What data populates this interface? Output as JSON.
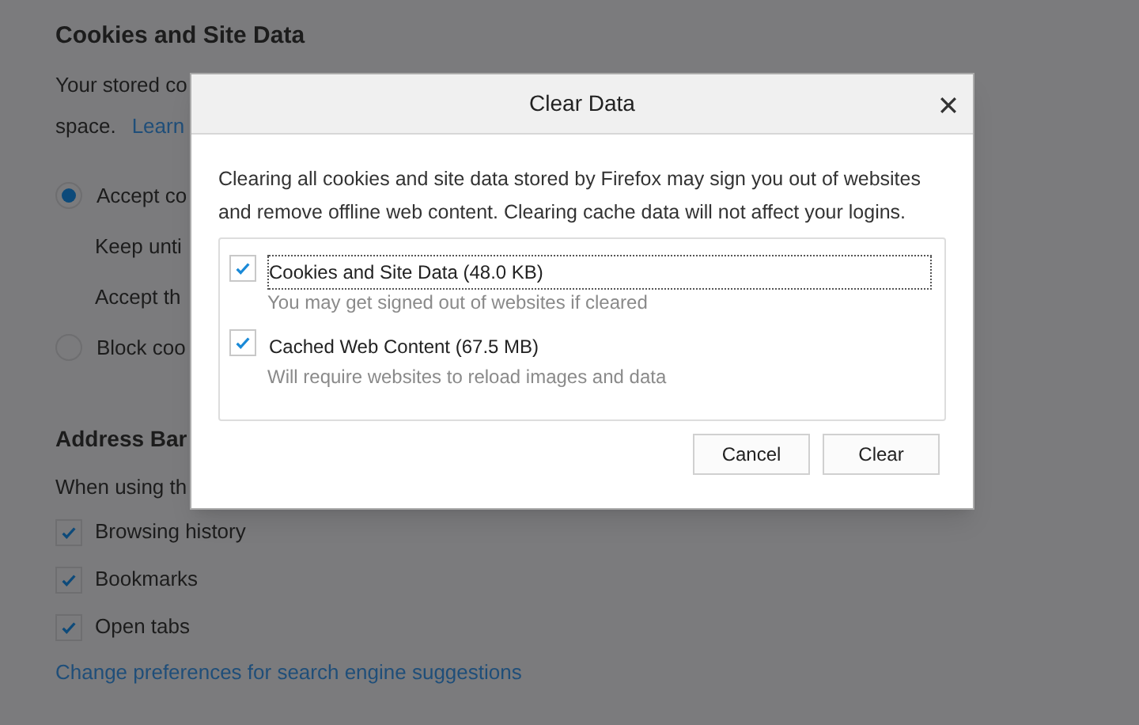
{
  "page": {
    "cookies_section": {
      "heading": "Cookies and Site Data",
      "description": "Your stored co",
      "description_line_2": "space.",
      "learn_link": "Learn",
      "options": [
        {
          "kind": "radio",
          "label": "Accept co",
          "selected": true
        },
        {
          "kind": "sub",
          "label": "Keep unti"
        },
        {
          "kind": "sub",
          "label": "Accept th"
        },
        {
          "kind": "radio",
          "label": "Block coo",
          "selected": false
        }
      ]
    },
    "address_bar_section": {
      "heading": "Address Bar",
      "description": "When using th",
      "options": [
        {
          "label": "Browsing history",
          "checked": true
        },
        {
          "label": "Bookmarks",
          "checked": true
        },
        {
          "label": "Open tabs",
          "checked": true
        }
      ],
      "link": "Change preferences for search engine suggestions"
    }
  },
  "dialog": {
    "heading": "Clear Data",
    "message": "Clearing all cookies and site data stored by Firefox may sign you out of websites and remove offline web content. Clearing cache data will not affect your logins.",
    "items": [
      {
        "label": "Cookies and Site Data (48.0 KB)",
        "note": "You may get signed out of websites if cleared",
        "checked": true,
        "focused": true
      },
      {
        "label": "Cached Web Content (67.5 MB)",
        "note": "Will require websites to reload images and data",
        "checked": true,
        "focused": false
      }
    ],
    "buttons": [
      "Cancel",
      "Clear"
    ]
  }
}
